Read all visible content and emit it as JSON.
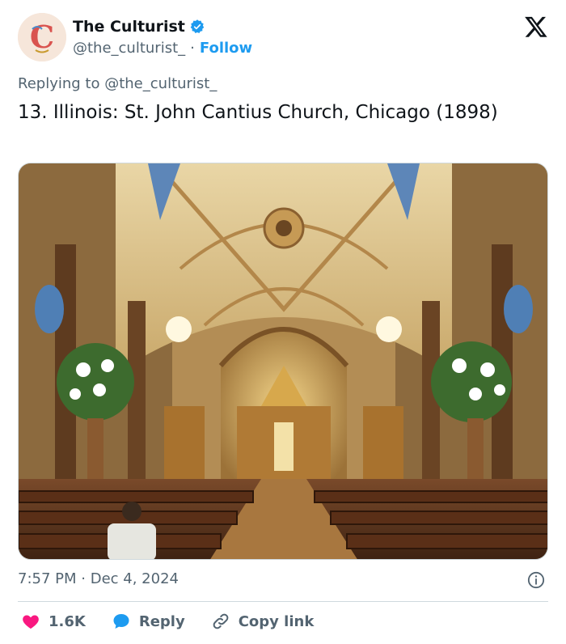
{
  "author": {
    "name": "The Culturist",
    "handle": "@the_culturist_",
    "separator": "·",
    "follow_label": "Follow",
    "avatar_letter": "C",
    "verified_color": "#1d9bf0"
  },
  "reply": {
    "prefix": "Replying to",
    "handle": "@the_culturist_"
  },
  "tweet": {
    "text": "13. Illinois: St. John Cantius Church, Chicago (1898)",
    "time": "7:57 PM",
    "separator": "·",
    "date": "Dec 4, 2024"
  },
  "actions": {
    "likes": "1.6K",
    "reply_label": "Reply",
    "copy_label": "Copy link"
  },
  "icons": {
    "close": "x-logo-icon",
    "info": "info-icon",
    "like": "heart-icon",
    "reply": "speech-bubble-icon",
    "link": "link-icon"
  },
  "colors": {
    "accent": "#1d9bf0",
    "like": "#f91880",
    "text_secondary": "#536471"
  }
}
